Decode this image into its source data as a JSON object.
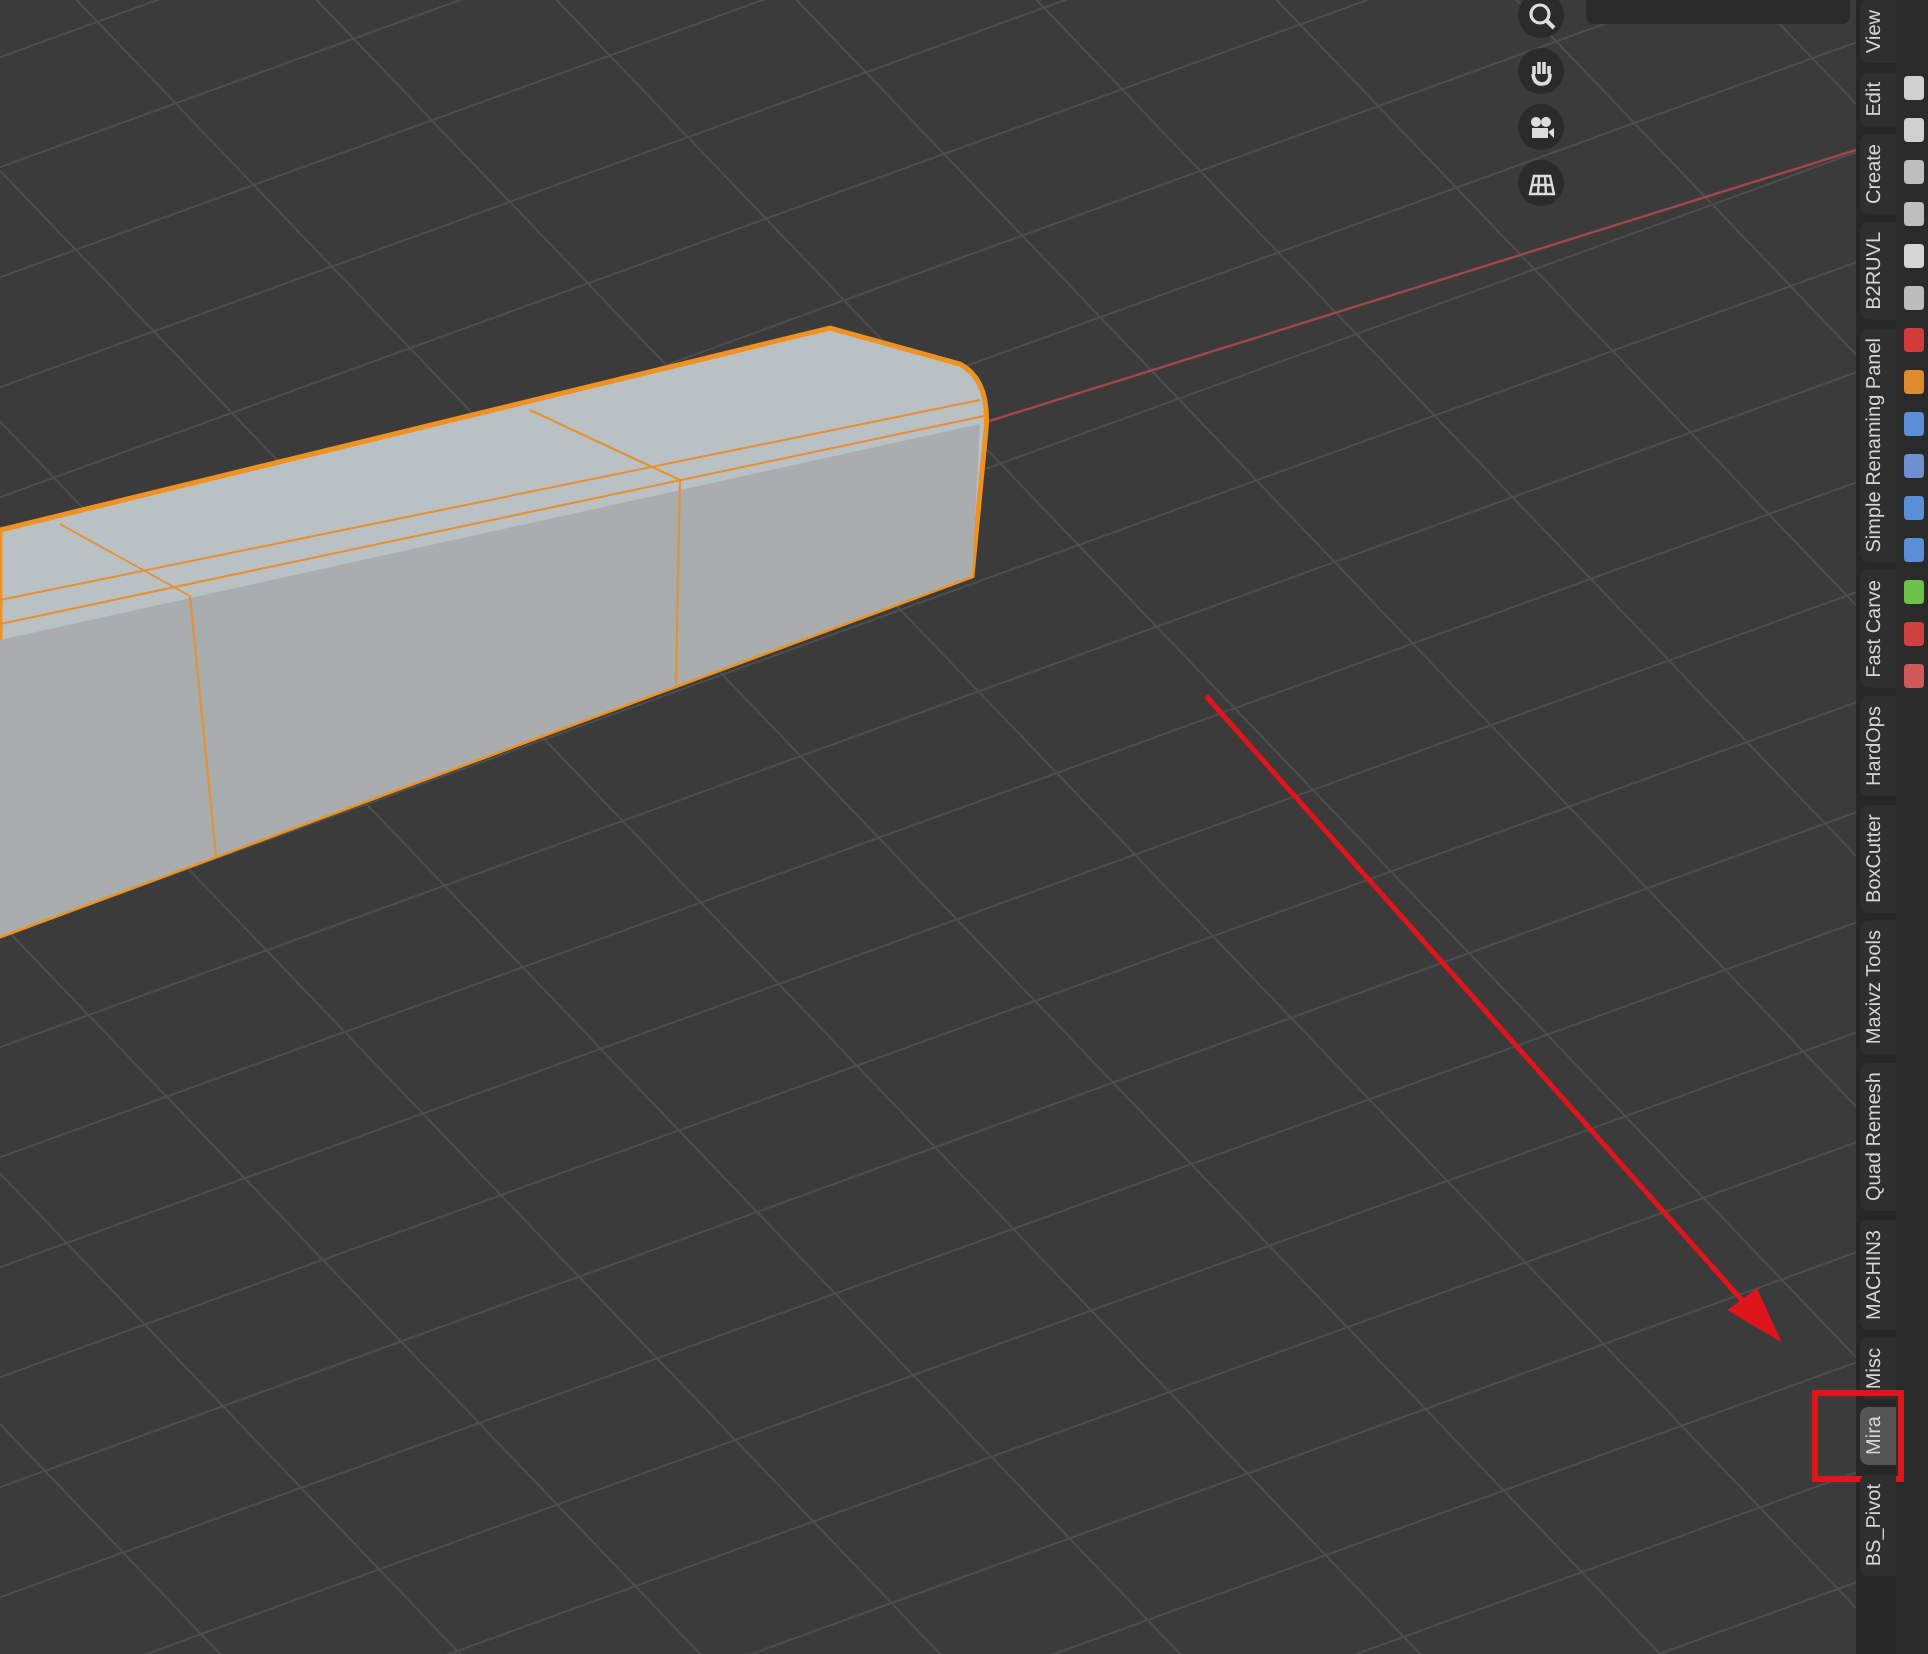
{
  "sidebar_tabs": [
    {
      "label": "View",
      "selected": false
    },
    {
      "label": "Edit",
      "selected": false
    },
    {
      "label": "Create",
      "selected": false
    },
    {
      "label": "B2RUVL",
      "selected": false
    },
    {
      "label": "Simple Renaming Panel",
      "selected": false
    },
    {
      "label": "Fast Carve",
      "selected": false
    },
    {
      "label": "HardOps",
      "selected": false
    },
    {
      "label": "BoxCutter",
      "selected": false
    },
    {
      "label": "Maxivz Tools",
      "selected": false
    },
    {
      "label": "Quad Remesh",
      "selected": false
    },
    {
      "label": "MACHIN3",
      "selected": false
    },
    {
      "label": "Misc",
      "selected": false
    },
    {
      "label": "Mira",
      "selected": true
    },
    {
      "label": "BS_Pivot",
      "selected": false
    }
  ]
}
